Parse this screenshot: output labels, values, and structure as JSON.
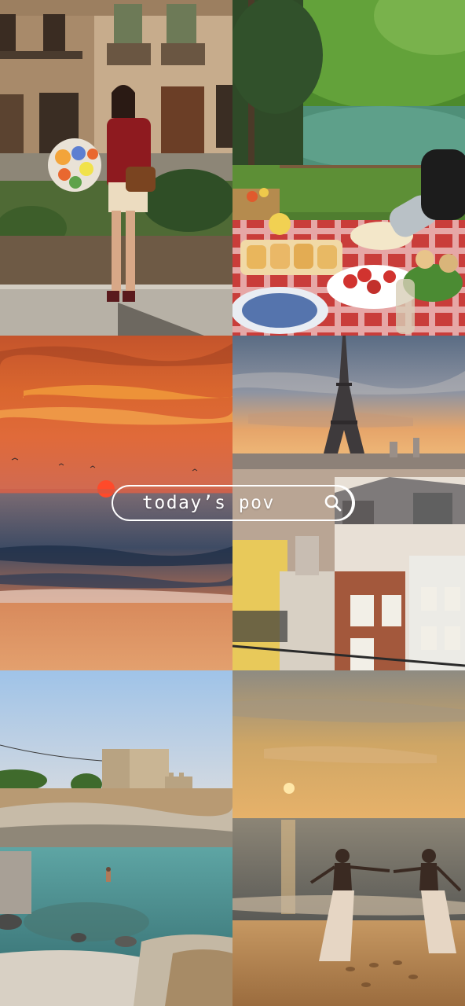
{
  "search": {
    "text": "today’s pov",
    "icon": "search-icon"
  },
  "tiles": [
    {
      "id": "city-street-portrait"
    },
    {
      "id": "lakeside-picnic"
    },
    {
      "id": "ocean-sunset"
    },
    {
      "id": "eiffel-tower-rooftops"
    },
    {
      "id": "stone-tower-cove"
    },
    {
      "id": "beach-sunset-dancers"
    }
  ]
}
